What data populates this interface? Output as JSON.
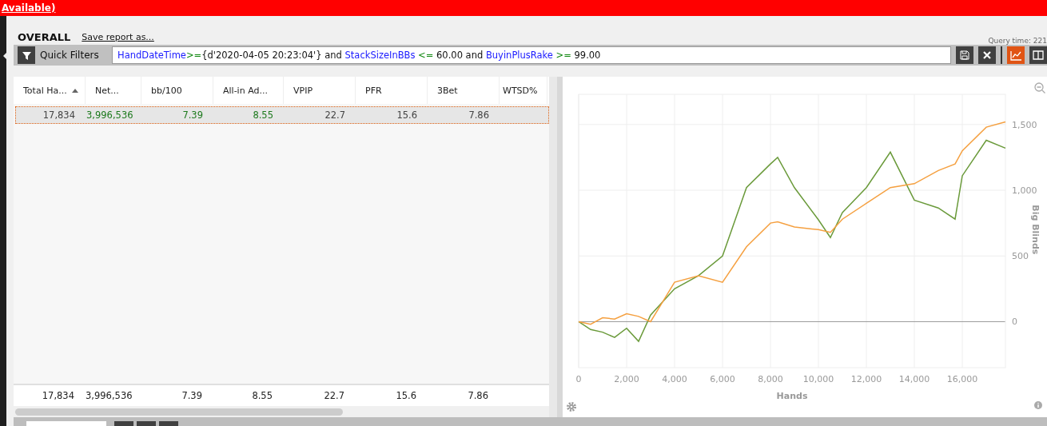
{
  "banner": {
    "text": "Available)"
  },
  "header": {
    "title": "OVERALL",
    "save_link": "Save report as...",
    "query_time": "Query time: 221"
  },
  "filter_bar": {
    "label": "Quick Filters",
    "expression": [
      {
        "kind": "field",
        "text": "HandDateTime"
      },
      {
        "kind": "op",
        "text": ">="
      },
      {
        "kind": "plain",
        "text": "{d'2020-04-05 20:23:04'} and "
      },
      {
        "kind": "field",
        "text": "StackSizeInBBs"
      },
      {
        "kind": "op",
        "text": " <="
      },
      {
        "kind": "plain",
        "text": " 60.00 and "
      },
      {
        "kind": "field",
        "text": "BuyinPlusRake"
      },
      {
        "kind": "op",
        "text": " >="
      },
      {
        "kind": "plain",
        "text": " 99.00"
      }
    ],
    "tools": [
      {
        "kind": "save",
        "selected": false
      },
      {
        "kind": "clear",
        "selected": false
      },
      {
        "kind": "chart",
        "selected": true
      },
      {
        "kind": "columns",
        "selected": false
      }
    ]
  },
  "table": {
    "columns": [
      {
        "label": "Total Ha...",
        "sorted": true
      },
      {
        "label": "Net...",
        "sorted": false
      },
      {
        "label": "bb/100",
        "sorted": false
      },
      {
        "label": "All-in Ad...",
        "sorted": false
      },
      {
        "label": "VPIP",
        "sorted": false
      },
      {
        "label": "PFR",
        "sorted": false
      },
      {
        "label": "3Bet",
        "sorted": false
      },
      {
        "label": "WTSD%",
        "sorted": false
      }
    ],
    "rows": [
      {
        "selected": true,
        "cells": [
          {
            "text": "17,834",
            "positive": false
          },
          {
            "text": "3,996,536",
            "positive": true
          },
          {
            "text": "7.39",
            "positive": true
          },
          {
            "text": "8.55",
            "positive": true
          },
          {
            "text": "22.7",
            "positive": false
          },
          {
            "text": "15.6",
            "positive": false
          },
          {
            "text": "7.86",
            "positive": false
          }
        ]
      }
    ],
    "totals": [
      "17,834",
      "3,996,536",
      "7.39",
      "8.55",
      "22.7",
      "15.6",
      "7.86"
    ]
  },
  "chart": {
    "chart_data": {
      "type": "line",
      "grid": true,
      "xlabel": "Hands",
      "ylabel": "Big Blinds",
      "xlim": [
        0,
        17800
      ],
      "ylim": [
        -350,
        1730
      ],
      "xticks": [
        {
          "value": 0,
          "label": "0"
        },
        {
          "value": 2000,
          "label": "2,000"
        },
        {
          "value": 4000,
          "label": "4,000"
        },
        {
          "value": 6000,
          "label": "6,000"
        },
        {
          "value": 8000,
          "label": "8,000"
        },
        {
          "value": 10000,
          "label": "10,000"
        },
        {
          "value": 12000,
          "label": "12,000"
        },
        {
          "value": 14000,
          "label": "14,000"
        },
        {
          "value": 16000,
          "label": "16,000"
        }
      ],
      "yticks": [
        {
          "value": 0,
          "label": "0"
        },
        {
          "value": 500,
          "label": "500"
        },
        {
          "value": 1000,
          "label": "1,000"
        },
        {
          "value": 1500,
          "label": "1,500"
        }
      ],
      "x": [
        0,
        500,
        1000,
        1500,
        2000,
        2500,
        3000,
        3500,
        4000,
        5000,
        6000,
        7000,
        8000,
        8300,
        9000,
        10000,
        10500,
        11000,
        12000,
        13000,
        14000,
        15000,
        15700,
        16000,
        17000,
        17800
      ],
      "series": [
        {
          "color": "#6a9a3a",
          "values": [
            0,
            -60,
            -80,
            -120,
            -50,
            -150,
            50,
            150,
            250,
            350,
            500,
            1020,
            1200,
            1250,
            1020,
            775,
            640,
            830,
            1020,
            1290,
            925,
            865,
            780,
            1110,
            1380,
            1320
          ]
        },
        {
          "color": "#f5a040",
          "values": [
            0,
            -20,
            30,
            20,
            60,
            40,
            0,
            150,
            300,
            350,
            300,
            570,
            750,
            760,
            720,
            700,
            680,
            780,
            900,
            1020,
            1050,
            1150,
            1200,
            1300,
            1480,
            1520
          ]
        }
      ]
    }
  }
}
